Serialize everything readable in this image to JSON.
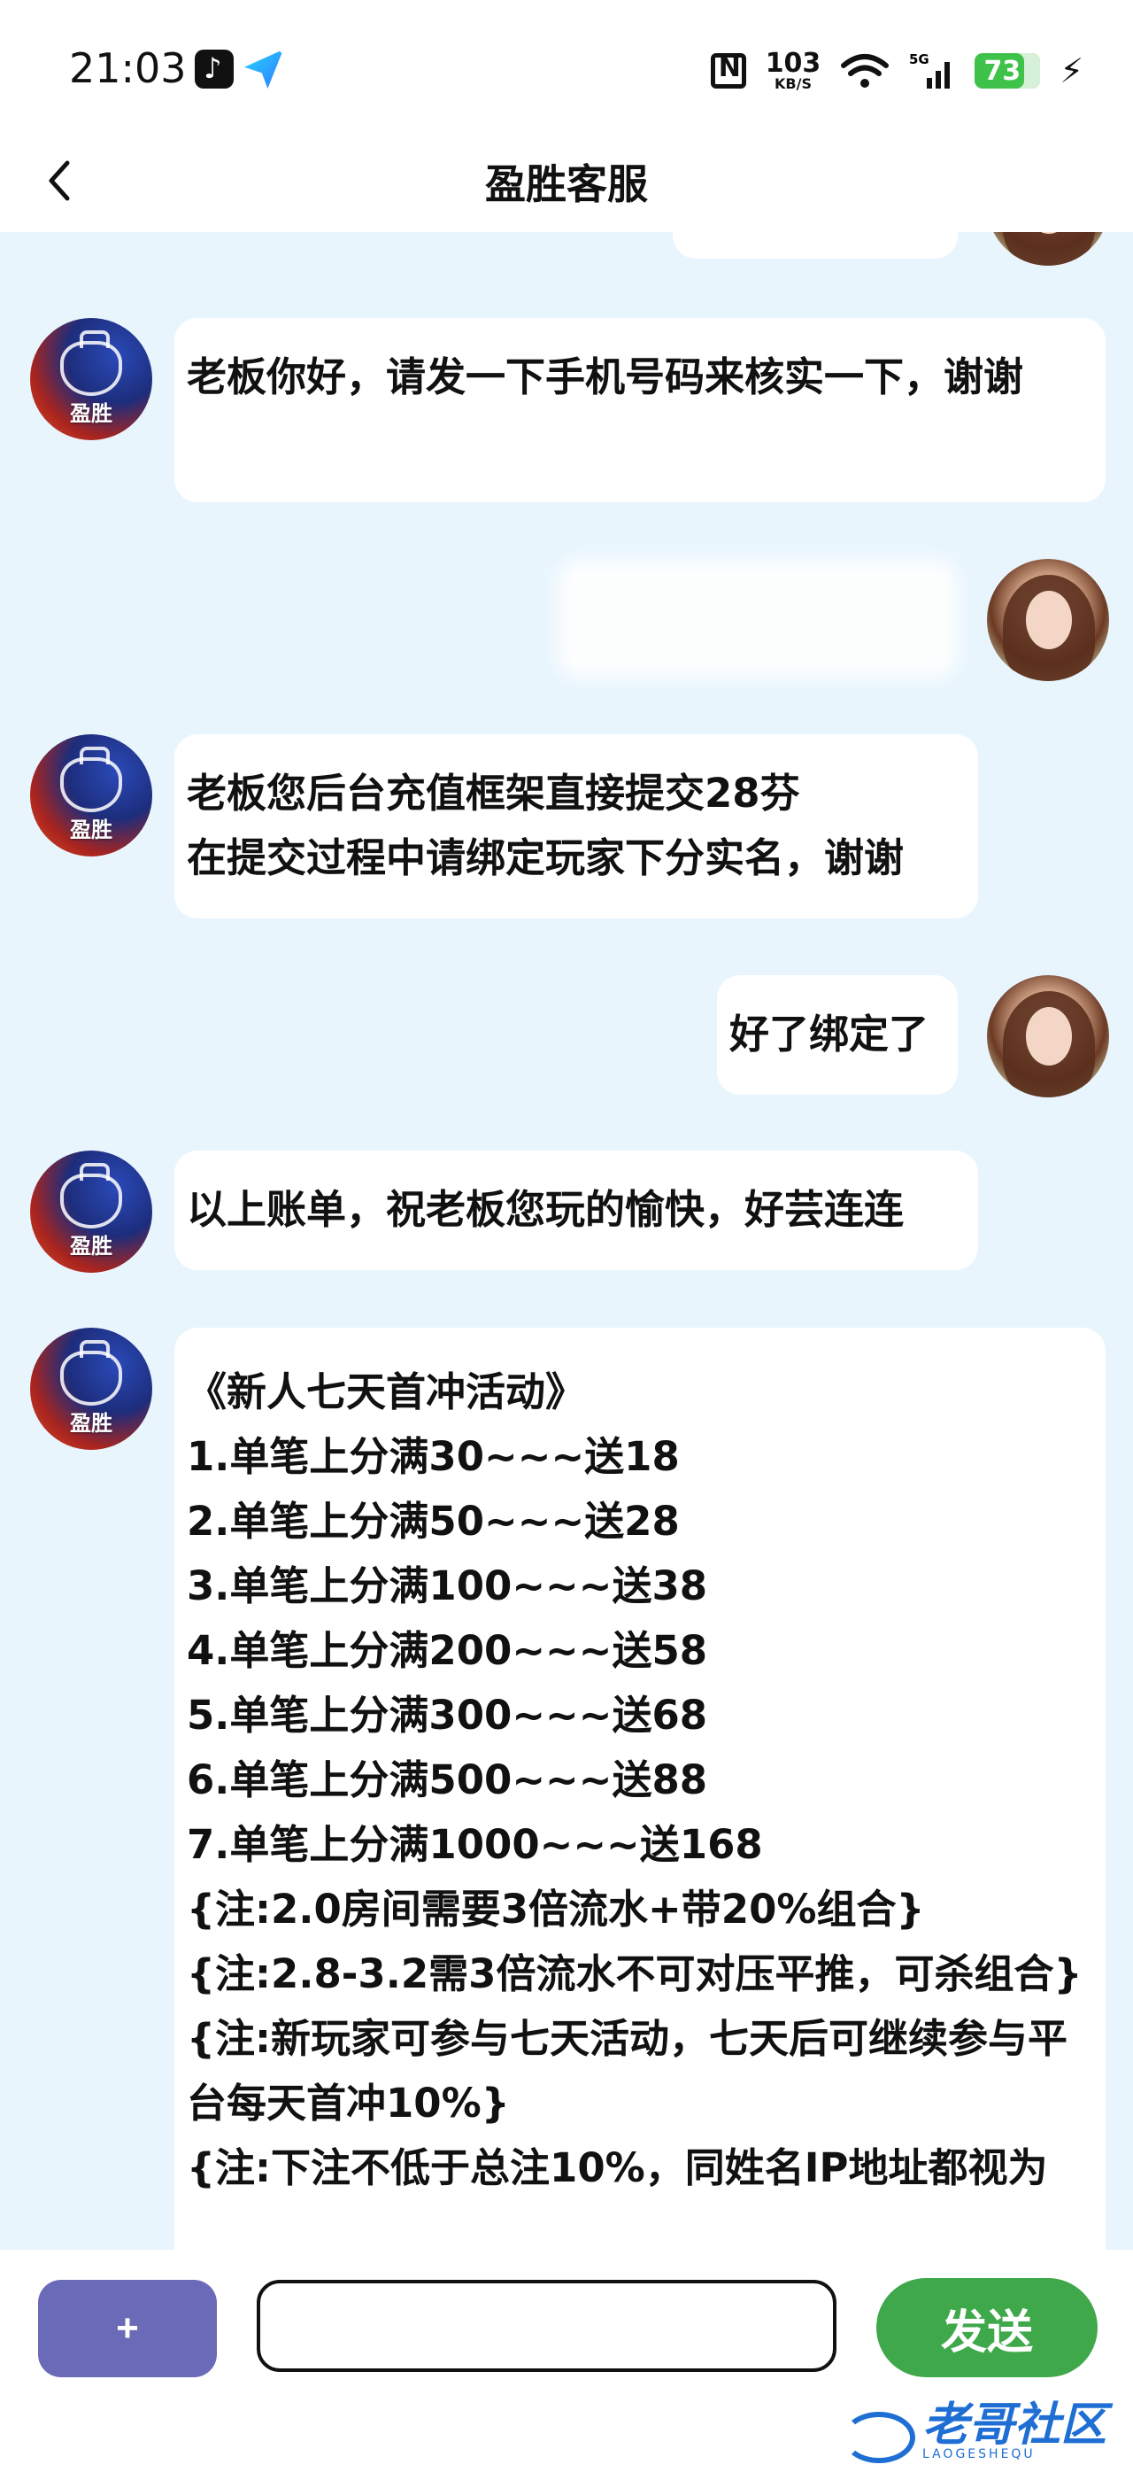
{
  "status_bar": {
    "time": "21:03",
    "network_speed_value": "103",
    "network_speed_unit": "KB/S",
    "cellular": "5G",
    "battery": "73",
    "app_icons": [
      "tiktok-icon",
      "send-icon"
    ]
  },
  "header": {
    "title": "盈胜客服"
  },
  "avatars": {
    "bot_brand": "盈胜"
  },
  "messages": [
    {
      "sender": "user",
      "text": ""
    },
    {
      "sender": "bot",
      "text": "老板你好，请发一下手机号码来核实一下，谢谢"
    },
    {
      "sender": "user",
      "text": ""
    },
    {
      "sender": "bot",
      "text": "老板您后台充值框架直接提交28芬\n在提交过程中请绑定玩家下分实名，谢谢"
    },
    {
      "sender": "user",
      "text": "好了绑定了"
    },
    {
      "sender": "bot",
      "text": "以上账单，祝老板您玩的愉快，好芸连连"
    },
    {
      "sender": "bot",
      "text": "《新人七天首冲活动》\n1.单笔上分满30~~~送18\n2.单笔上分满50~~~送28\n3.单笔上分满100~~~送38\n4.单笔上分满200~~~送58\n5.单笔上分满300~~~送68\n6.单笔上分满500~~~送88\n7.单笔上分满1000~~~送168\n{注:2.0房间需要3倍流水+带20%组合}\n{注:2.8-3.2需3倍流水不可对压平推，可杀组合}\n{注:新玩家可参与七天活动，七天后可继续参与平台每天首冲10%}\n{注:下注不低于总注10%，同姓名IP地址都视为"
    }
  ],
  "input_bar": {
    "plus_label": "+",
    "input_value": "",
    "send_label": "发送"
  },
  "watermark": {
    "text": "老哥社区",
    "subtext": "LAOGESHEQU"
  },
  "colors": {
    "chat_bg": "#e8f5fd",
    "bubble_bg": "#ffffff",
    "plus_button": "#6a6ab8",
    "send_button": "#3fa84a",
    "battery": "#3fc24a"
  }
}
